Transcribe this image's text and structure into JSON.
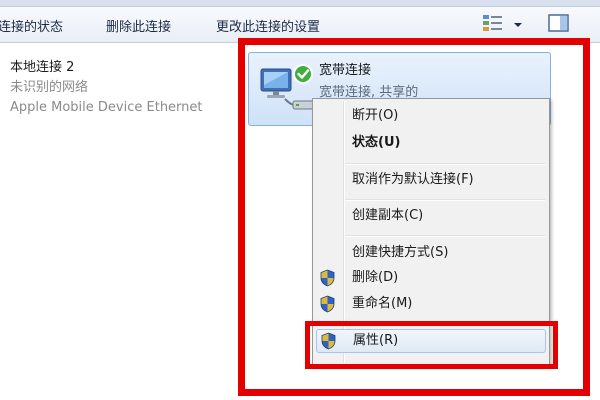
{
  "toolbar": {
    "items": [
      "连接的状态",
      "删除此连接",
      "更改此连接的设置"
    ]
  },
  "connections": {
    "local": {
      "name": "本地连接 2",
      "status": "未识别的网络",
      "adapter": "Apple Mobile Device Ethernet"
    },
    "broadband": {
      "name": "宽带连接",
      "status": "宽带连接, 共享的",
      "selected": true
    }
  },
  "context_menu": {
    "items": [
      {
        "label": "断开(O)"
      },
      {
        "label": "状态(U)",
        "default": true
      },
      {
        "label": "取消作为默认连接(F)"
      },
      {
        "label": "创建副本(C)"
      },
      {
        "label": "创建快捷方式(S)"
      },
      {
        "label": "删除(D)",
        "icon": "uac-shield-icon"
      },
      {
        "label": "重命名(M)",
        "icon": "uac-shield-icon"
      },
      {
        "label": "属性(R)",
        "icon": "uac-shield-icon",
        "highlighted": true
      }
    ]
  },
  "colors": {
    "highlight_border": "#e30000",
    "selection_fill": "#cfe2f8",
    "toolbar_text": "#1c2b45"
  }
}
